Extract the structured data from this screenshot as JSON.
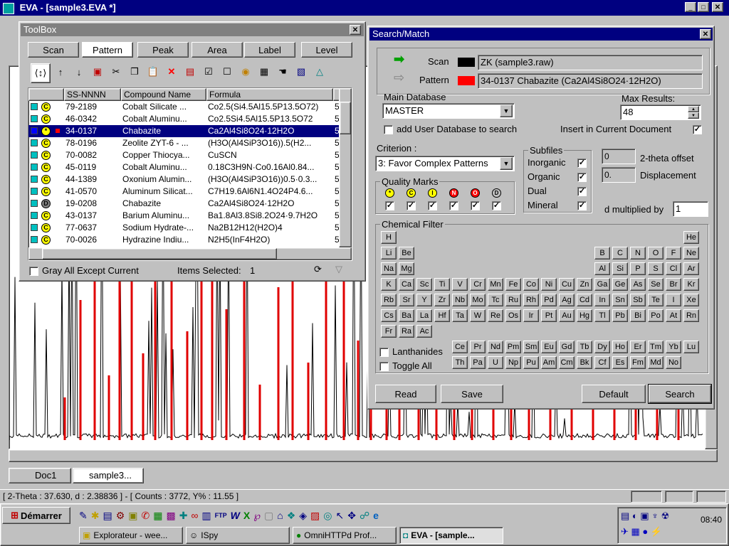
{
  "app": {
    "title": "EVA - [sample3.EVA *]"
  },
  "toolbox": {
    "title": "ToolBox",
    "tabs": [
      "Scan",
      "Pattern",
      "Peak",
      "Area",
      "Label",
      "Level"
    ],
    "columns": [
      "SS-NNNN",
      "Compound Name",
      "Formula"
    ],
    "rows": [
      {
        "swatch": "#00c0c0",
        "mark": "C",
        "ss": "79-2189",
        "name": "Cobalt Silicate ...",
        "formula": "Co2.5(Si4.5Al15.5P13.5O72)",
        "n": "5"
      },
      {
        "swatch": "#00c0c0",
        "mark": "C",
        "ss": "46-0342",
        "name": "Cobalt Aluminu...",
        "formula": "Co2.5Si4.5Al15.5P13.5O72",
        "n": "5"
      },
      {
        "swatch": "#0000ff",
        "mark": "*",
        "ss": "34-0137",
        "name": "Chabazite",
        "formula": "Ca2Al4Si8O24·12H2O",
        "n": "5",
        "selected": true
      },
      {
        "swatch": "#00c0c0",
        "mark": "C",
        "ss": "78-0196",
        "name": "Zeolite ZYT-6 - ...",
        "formula": "(H3O(Al4SiP3O16)).5(H2...",
        "n": "5"
      },
      {
        "swatch": "#00c0c0",
        "mark": "C",
        "ss": "70-0082",
        "name": "Copper Thiocya...",
        "formula": "CuSCN",
        "n": "5"
      },
      {
        "swatch": "#00c0c0",
        "mark": "C",
        "ss": "45-0119",
        "name": "Cobalt Aluminu...",
        "formula": "0.18C3H9N·Co0.16Al0.84...",
        "n": "5"
      },
      {
        "swatch": "#00c0c0",
        "mark": "C",
        "ss": "44-1389",
        "name": "Oxonium Alumin...",
        "formula": "(H3O(Al4SiP3O16))0.5·0.3...",
        "n": "5"
      },
      {
        "swatch": "#00c0c0",
        "mark": "C",
        "ss": "41-0570",
        "name": "Aluminum Silicat...",
        "formula": "C7H19.6Al6N1.4O24P4.6...",
        "n": "5"
      },
      {
        "swatch": "#00c0c0",
        "mark": "D",
        "ss": "19-0208",
        "name": "Chabazite",
        "formula": "Ca2Al4Si8O24·12H2O",
        "n": "5"
      },
      {
        "swatch": "#00c0c0",
        "mark": "C",
        "ss": "43-0137",
        "name": "Barium Aluminu...",
        "formula": "Ba1.8Al3.8Si8.2O24·9.7H2O",
        "n": "5"
      },
      {
        "swatch": "#00c0c0",
        "mark": "C",
        "ss": "77-0637",
        "name": "Sodium Hydrate-...",
        "formula": "Na2B12H12(H2O)4",
        "n": "5"
      },
      {
        "swatch": "#00c0c0",
        "mark": "C",
        "ss": "70-0026",
        "name": "Hydrazine Indiu...",
        "formula": "N2H5(InF4H2O)",
        "n": "5"
      }
    ],
    "gray_all_label": "Gray All Except Current",
    "items_selected_label": "Items Selected:",
    "items_selected_count": "1"
  },
  "search": {
    "title": "Search/Match",
    "scan_label": "Scan",
    "scan_value": "ZK (sample3.raw)",
    "pattern_label": "Pattern",
    "pattern_value": "34-0137 Chabazite (Ca2Al4Si8O24·12H2O)",
    "main_db_label": "Main Database",
    "main_db_value": "MASTER",
    "max_results_label": "Max Results:",
    "max_results_value": "48",
    "add_user_db_label": "add User Database to search",
    "insert_doc_label": "Insert in Current Document",
    "criterion_label": "Criterion :",
    "criterion_value": "3: Favor Complex Patterns",
    "subfiles_label": "Subfiles",
    "subfiles": [
      "Inorganic",
      "Organic",
      "Dual",
      "Mineral"
    ],
    "quality_label": "Quality Marks",
    "quality_marks": [
      {
        "sym": "*",
        "color": "#ffff00"
      },
      {
        "sym": "C",
        "color": "#ffff00"
      },
      {
        "sym": "I",
        "color": "#ffff00"
      },
      {
        "sym": "N",
        "color": "#ff0000"
      },
      {
        "sym": "O",
        "color": "#ff0000"
      },
      {
        "sym": "D",
        "color": "#c0c0c0"
      }
    ],
    "two_theta_value": "0",
    "two_theta_label": "2-theta offset",
    "displacement_value": "0.",
    "displacement_label": "Displacement",
    "d_mult_label": "d multiplied by",
    "d_mult_value": "1",
    "chem_filter_label": "Chemical Filter",
    "lanthanides_label": "Lanthanides",
    "toggle_all_label": "Toggle All",
    "buttons": {
      "read": "Read",
      "save": "Save",
      "default": "Default",
      "search": "Search"
    }
  },
  "elements": {
    "rows": [
      [
        "H",
        "",
        "",
        "",
        "",
        "",
        "",
        "",
        "",
        "",
        "",
        "",
        "",
        "",
        "",
        "",
        "",
        "He"
      ],
      [
        "Li",
        "Be",
        "",
        "",
        "",
        "",
        "",
        "",
        "",
        "",
        "",
        "",
        "B",
        "C",
        "N",
        "O",
        "F",
        "Ne"
      ],
      [
        "Na",
        "Mg",
        "",
        "",
        "",
        "",
        "",
        "",
        "",
        "",
        "",
        "",
        "Al",
        "Si",
        "P",
        "S",
        "Cl",
        "Ar"
      ],
      [
        "K",
        "Ca",
        "Sc",
        "Ti",
        "V",
        "Cr",
        "Mn",
        "Fe",
        "Co",
        "Ni",
        "Cu",
        "Zn",
        "Ga",
        "Ge",
        "As",
        "Se",
        "Br",
        "Kr"
      ],
      [
        "Rb",
        "Sr",
        "Y",
        "Zr",
        "Nb",
        "Mo",
        "Tc",
        "Ru",
        "Rh",
        "Pd",
        "Ag",
        "Cd",
        "In",
        "Sn",
        "Sb",
        "Te",
        "I",
        "Xe"
      ],
      [
        "Cs",
        "Ba",
        "La",
        "Hf",
        "Ta",
        "W",
        "Re",
        "Os",
        "Ir",
        "Pt",
        "Au",
        "Hg",
        "Tl",
        "Pb",
        "Bi",
        "Po",
        "At",
        "Rn"
      ],
      [
        "Fr",
        "Ra",
        "Ac"
      ]
    ],
    "lanthanides": [
      "Ce",
      "Pr",
      "Nd",
      "Pm",
      "Sm",
      "Eu",
      "Gd",
      "Tb",
      "Dy",
      "Ho",
      "Er",
      "Tm",
      "Yb",
      "Lu"
    ],
    "actinides": [
      "Th",
      "Pa",
      "U",
      "Np",
      "Pu",
      "Am",
      "Cm",
      "Bk",
      "Cf",
      "Es",
      "Fm",
      "Md",
      "No"
    ]
  },
  "doc_tabs": [
    "Doc1",
    "sample3..."
  ],
  "status": {
    "text": "[ 2-Theta : 37.630, d : 2.38836 ] - [ Counts : 3772, Y% : 11.55 ]"
  },
  "taskbar": {
    "start": "Démarrer",
    "tasks": [
      "Explorateur - wee...",
      "ISpy",
      "OmniHTTPd Prof...",
      "EVA - [sample..."
    ],
    "clock": "08:40"
  }
}
